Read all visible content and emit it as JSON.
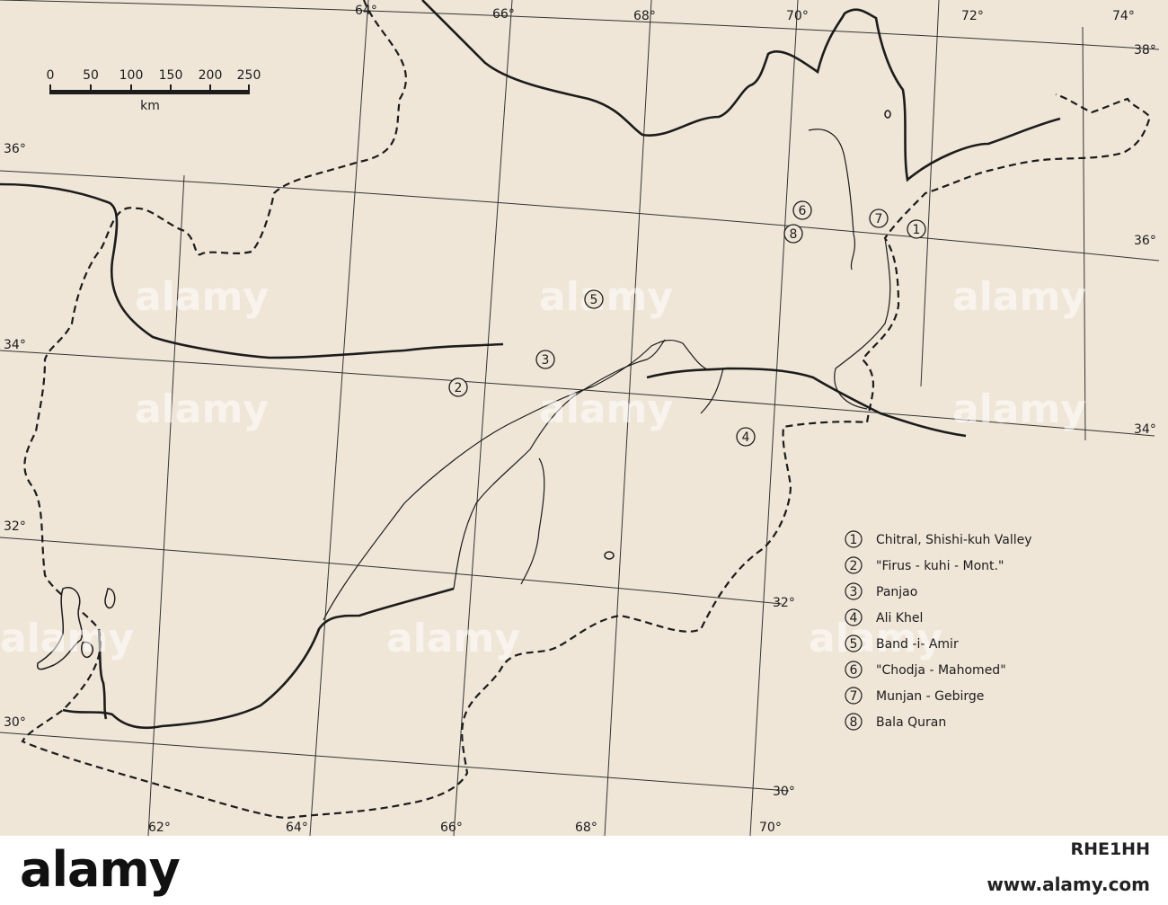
{
  "colors": {
    "paper": "#efe6d8",
    "ink": "#1c1c1c",
    "watermark": "#ffffff"
  },
  "grid_labels": {
    "top": [
      "64°",
      "66°",
      "68°",
      "70°",
      "72°",
      "74°"
    ],
    "bottom": [
      "62°",
      "64°",
      "66°",
      "68°",
      "70°"
    ],
    "left": [
      "36°",
      "34°",
      "32°",
      "30°"
    ],
    "right": [
      "38°",
      "36°",
      "34°",
      "32°",
      "30°"
    ]
  },
  "scale_bar": {
    "ticks": [
      "0",
      "50",
      "100",
      "150",
      "200",
      "250"
    ],
    "unit": "km"
  },
  "markers": [
    "1",
    "2",
    "3",
    "4",
    "5",
    "6",
    "7",
    "8"
  ],
  "legend": [
    {
      "num": "1",
      "label": "Chitral, Shishi-kuh Valley"
    },
    {
      "num": "2",
      "label": "\"Firus - kuhi - Mont.\""
    },
    {
      "num": "3",
      "label": "Panjao"
    },
    {
      "num": "4",
      "label": "Ali Khel"
    },
    {
      "num": "5",
      "label": "Band -i- Amir"
    },
    {
      "num": "6",
      "label": "\"Chodja - Mahomed\""
    },
    {
      "num": "7",
      "label": "Munjan - Gebirge"
    },
    {
      "num": "8",
      "label": "Bala Quran"
    }
  ],
  "watermark_text": "alamy",
  "footer": {
    "brand": "alamy",
    "image_id": "RHE1HH",
    "url": "www.alamy.com"
  }
}
